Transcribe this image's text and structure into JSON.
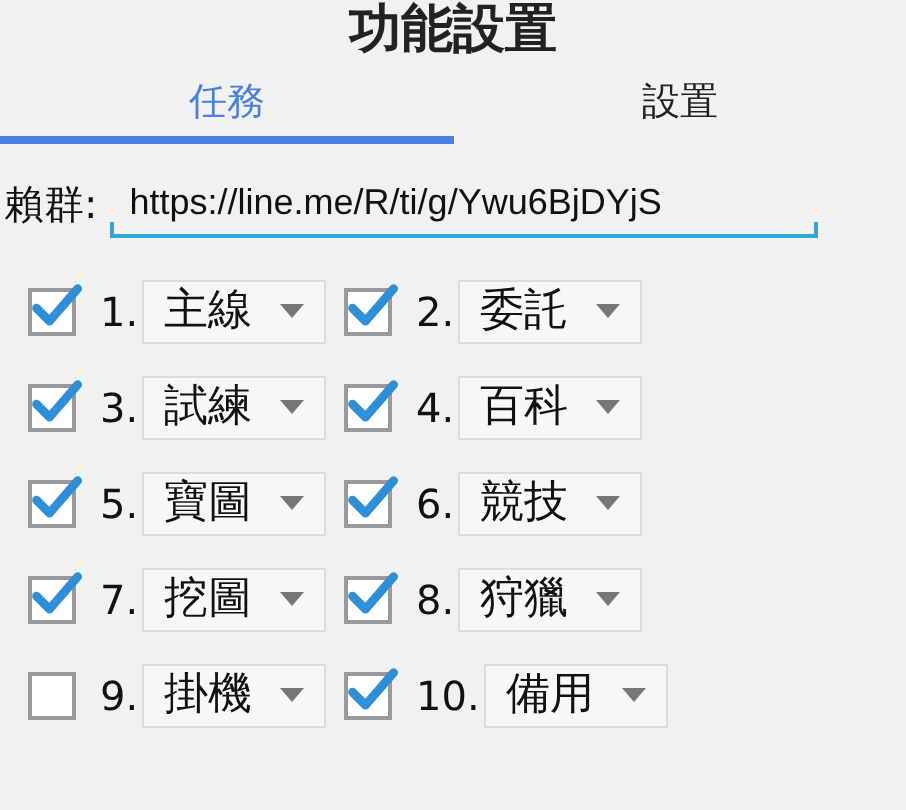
{
  "title": "功能設置",
  "tabs": [
    {
      "label": "任務",
      "selected": true
    },
    {
      "label": "設置",
      "selected": false
    }
  ],
  "line_group": {
    "label": "賴群:",
    "value": "https://line.me/R/ti/g/Ywu6BjDYjS"
  },
  "tasks": [
    {
      "number": "1.",
      "option": "主線",
      "checked": true
    },
    {
      "number": "2.",
      "option": "委託",
      "checked": true
    },
    {
      "number": "3.",
      "option": "試練",
      "checked": true
    },
    {
      "number": "4.",
      "option": "百科",
      "checked": true
    },
    {
      "number": "5.",
      "option": "寶圖",
      "checked": true
    },
    {
      "number": "6.",
      "option": "競技",
      "checked": true
    },
    {
      "number": "7.",
      "option": "挖圖",
      "checked": true
    },
    {
      "number": "8.",
      "option": "狩獵",
      "checked": true
    },
    {
      "number": "9.",
      "option": "掛機",
      "checked": false
    },
    {
      "number": "10.",
      "option": "備用",
      "checked": true
    }
  ]
}
